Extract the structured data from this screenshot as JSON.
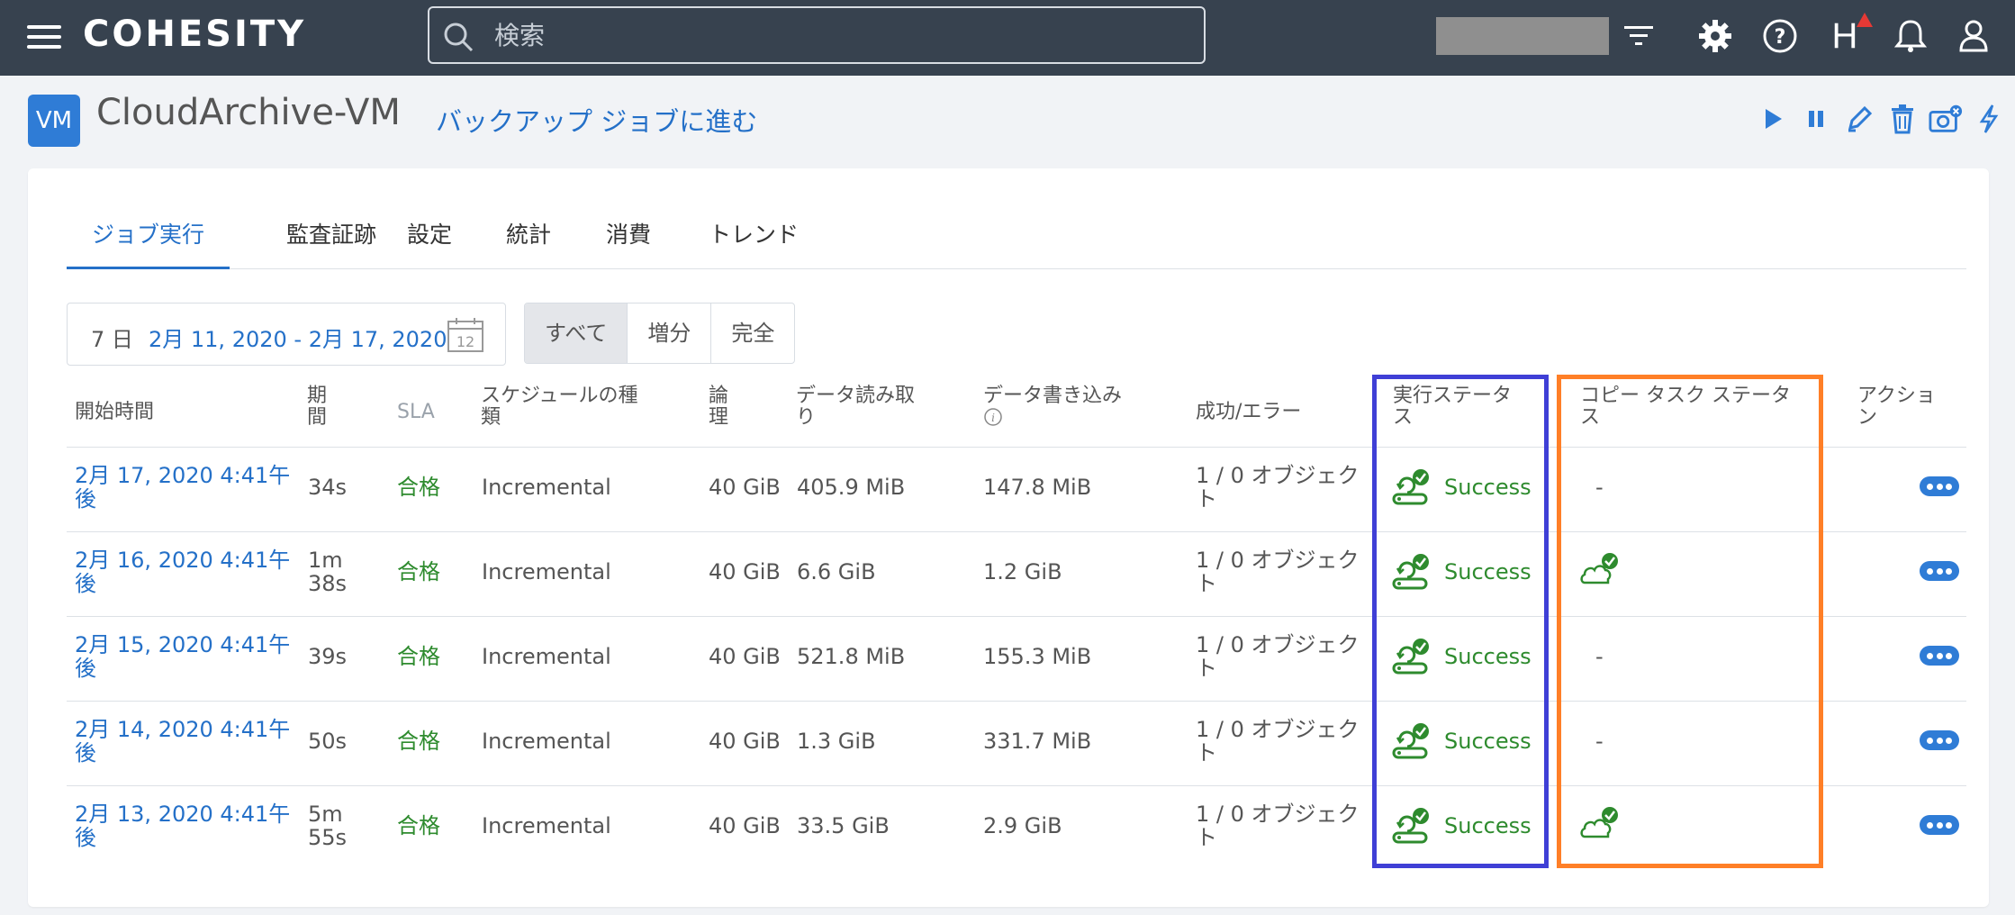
{
  "topbar": {
    "logo": "COHESITY",
    "search_placeholder": "検索",
    "h_label": "H"
  },
  "header": {
    "badge": "VM",
    "title": "CloudArchive-VM",
    "link": "バックアップ ジョブに進む"
  },
  "tabs": [
    "ジョブ実行",
    "監査証跡",
    "設定",
    "統計",
    "消費",
    "トレンド"
  ],
  "filter": {
    "prefix": "7 日",
    "range": "2月 11, 2020 - 2月 17, 2020",
    "calendar_day": "12",
    "segments": [
      "すべて",
      "増分",
      "完全"
    ]
  },
  "table": {
    "headers": {
      "start": "開始時間",
      "duration": "期\n間",
      "sla": "SLA",
      "schedule": "スケジュールの種\n類",
      "logical": "論\n理",
      "read": "データ読み取\nり",
      "write": "データ書き込み",
      "success_error": "成功/エラー",
      "run_status": "実行ステータ\nス",
      "copy_status": "コピー タスク ステータ\nス",
      "actions": "アクショ\nン"
    },
    "rows": [
      {
        "start": "2月 17, 2020 4:41午\n後",
        "duration": "34s",
        "sla": "合格",
        "schedule": "Incremental",
        "logical": "40 GiB",
        "read": "405.9 MiB",
        "write": "147.8 MiB",
        "success_error": "1 / 0 オブジェク\nト",
        "run_status": "Success",
        "copy_status": "-",
        "copy_icon": "none"
      },
      {
        "start": "2月 16, 2020 4:41午\n後",
        "duration": "1m\n38s",
        "sla": "合格",
        "schedule": "Incremental",
        "logical": "40 GiB",
        "read": "6.6 GiB",
        "write": "1.2 GiB",
        "success_error": "1 / 0 オブジェク\nト",
        "run_status": "Success",
        "copy_status": "",
        "copy_icon": "cloud-check-icon"
      },
      {
        "start": "2月 15, 2020 4:41午\n後",
        "duration": "39s",
        "sla": "合格",
        "schedule": "Incremental",
        "logical": "40 GiB",
        "read": "521.8 MiB",
        "write": "155.3 MiB",
        "success_error": "1 / 0 オブジェク\nト",
        "run_status": "Success",
        "copy_status": "-",
        "copy_icon": "none"
      },
      {
        "start": "2月 14, 2020 4:41午\n後",
        "duration": "50s",
        "sla": "合格",
        "schedule": "Incremental",
        "logical": "40 GiB",
        "read": "1.3 GiB",
        "write": "331.7 MiB",
        "success_error": "1 / 0 オブジェク\nト",
        "run_status": "Success",
        "copy_status": "-",
        "copy_icon": "none"
      },
      {
        "start": "2月 13, 2020 4:41午\n後",
        "duration": "5m\n55s",
        "sla": "合格",
        "schedule": "Incremental",
        "logical": "40 GiB",
        "read": "33.5 GiB",
        "write": "2.9 GiB",
        "success_error": "1 / 0 オブジェク\nト",
        "run_status": "Success",
        "copy_status": "",
        "copy_icon": "cloud-check-icon"
      }
    ]
  },
  "colors": {
    "topbar": "#37424f",
    "accent": "#2470c8",
    "success": "#2e8b2e",
    "highlight_run": "#3f3fd6",
    "highlight_copy": "#ff7f27"
  }
}
